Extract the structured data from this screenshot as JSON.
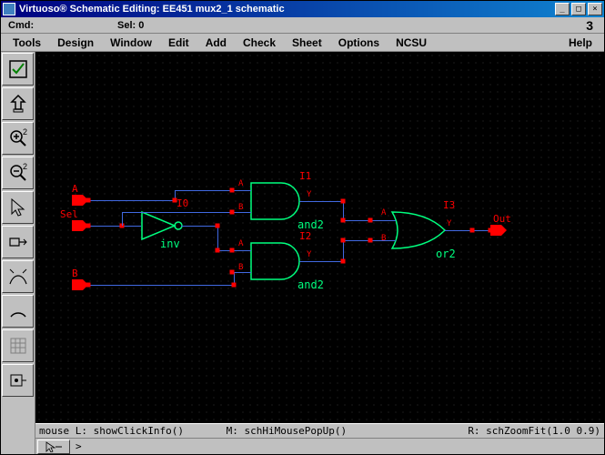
{
  "title": "Virtuoso® Schematic Editing: EE451 mux2_1 schematic",
  "cmd_bar": {
    "cmd_label": "Cmd:",
    "sel_label": "Sel: 0",
    "count": "3"
  },
  "menu": {
    "items": [
      "Tools",
      "Design",
      "Window",
      "Edit",
      "Add",
      "Check",
      "Sheet",
      "Options",
      "NCSU"
    ],
    "help": "Help"
  },
  "toolbar": {
    "check": "check-icon",
    "save": "save-icon",
    "zoom_in": "zoom-in-icon",
    "zoom_out": "zoom-out-icon",
    "select": "select-icon",
    "stretch": "stretch-icon",
    "wire": "wire-icon",
    "arc": "arc-icon",
    "grid": "grid-icon",
    "probe": "probe-icon"
  },
  "schematic": {
    "pins": {
      "A": "A",
      "Sel": "Sel",
      "B": "B",
      "Out": "Out"
    },
    "instances": {
      "I0": {
        "name": "I0",
        "type": "inv"
      },
      "I1": {
        "name": "I1",
        "type": "and2"
      },
      "I2": {
        "name": "I2",
        "type": "and2"
      },
      "I3": {
        "name": "I3",
        "type": "or2"
      }
    },
    "port_labels": {
      "A": "A",
      "B": "B",
      "Y": "Y"
    }
  },
  "status": {
    "left": "mouse L: showClickInfo()",
    "mid": "M: schHiMousePopUp()",
    "right": "R: schZoomFit(1.0 0.9)"
  },
  "prompt": "> "
}
